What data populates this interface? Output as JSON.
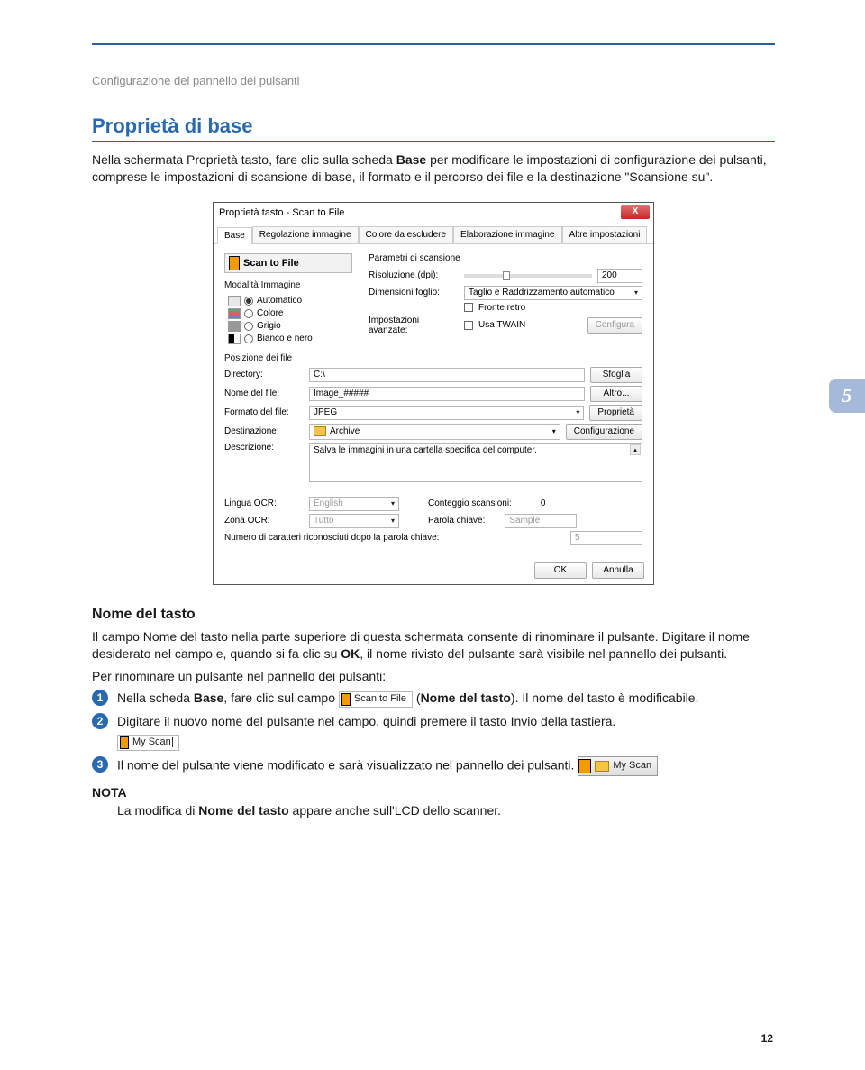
{
  "breadcrumb": "Configurazione del pannello dei pulsanti",
  "h1": "Proprietà di base",
  "intro_p1a": "Nella schermata Proprietà tasto, fare clic sulla scheda ",
  "intro_p1b": "Base",
  "intro_p1c": " per modificare le impostazioni di configurazione dei pulsanti, comprese le impostazioni di scansione di base, il formato e il percorso dei file e la destinazione \"Scansione su\".",
  "chapter": "5",
  "dialog": {
    "title": "Proprietà tasto - Scan to File",
    "close": "X",
    "tabs": [
      "Base",
      "Regolazione immagine",
      "Colore da escludere",
      "Elaborazione immagine",
      "Altre impostazioni"
    ],
    "btn_name": "Scan to File",
    "img_mode_label": "Modalità Immagine",
    "modes": {
      "auto": "Automatico",
      "color": "Colore",
      "gray": "Grigio",
      "bw": "Bianco e nero"
    },
    "scan_params": "Parametri di scansione",
    "resolution": "Risoluzione (dpi):",
    "resolution_val": "200",
    "dim": "Dimensioni foglio:",
    "dim_val": "Taglio e Raddrizzamento automatico",
    "fronte_retro": "Fronte retro",
    "adv": "Impostazioni avanzate:",
    "twain": "Usa TWAIN",
    "configura": "Configura",
    "file_pos": "Posizione dei file",
    "directory": "Directory:",
    "directory_val": "C:\\",
    "sfoglia": "Sfoglia",
    "nome_file": "Nome del file:",
    "nome_file_val": "Image_#####",
    "altro": "Altro...",
    "formato": "Formato del file:",
    "formato_val": "JPEG",
    "proprieta": "Proprietà",
    "destinazione": "Destinazione:",
    "destinazione_val": "Archive",
    "configurazione": "Configurazione",
    "descrizione": "Descrizione:",
    "descrizione_val": "Salva le immagini in una cartella specifica del computer.",
    "lingua_ocr": "Lingua OCR:",
    "lingua_ocr_val": "English",
    "conteggio": "Conteggio scansioni:",
    "conteggio_val": "0",
    "zona_ocr": "Zona OCR:",
    "zona_ocr_val": "Tutto",
    "parola": "Parola chiave:",
    "parola_val": "Sample",
    "numcar": "Numero di caratteri riconosciuti dopo la parola chiave:",
    "numcar_val": "5",
    "ok": "OK",
    "annulla": "Annulla"
  },
  "section": {
    "title": "Nome del tasto",
    "p1": "Il campo Nome del tasto nella parte superiore di questa schermata consente di rinominare il pulsante. Digitare il nome desiderato nel campo e, quando si fa clic su ",
    "p1b": "OK",
    "p1c": ", il nome rivisto del pulsante sarà visibile nel pannello dei pulsanti.",
    "p2": "Per rinominare un pulsante nel pannello dei pulsanti:",
    "s1a": "Nella scheda ",
    "s1b": "Base",
    "s1c": ", fare clic sul campo ",
    "s1img": "Scan to File",
    "s1d": " (",
    "s1e": "Nome del tasto",
    "s1f": "). Il nome del tasto è modificabile.",
    "s2": "Digitare il nuovo nome del pulsante nel campo, quindi premere il tasto Invio della tastiera.",
    "s2img": "My Scan",
    "s3": "Il nome del pulsante viene modificato e sarà visualizzato nel pannello dei pulsanti.",
    "s3badge": "My Scan",
    "nota": "NOTA",
    "nota_a": "La modifica di ",
    "nota_b": "Nome del tasto",
    "nota_c": " appare anche sull'LCD dello scanner."
  },
  "pagenum": "12"
}
